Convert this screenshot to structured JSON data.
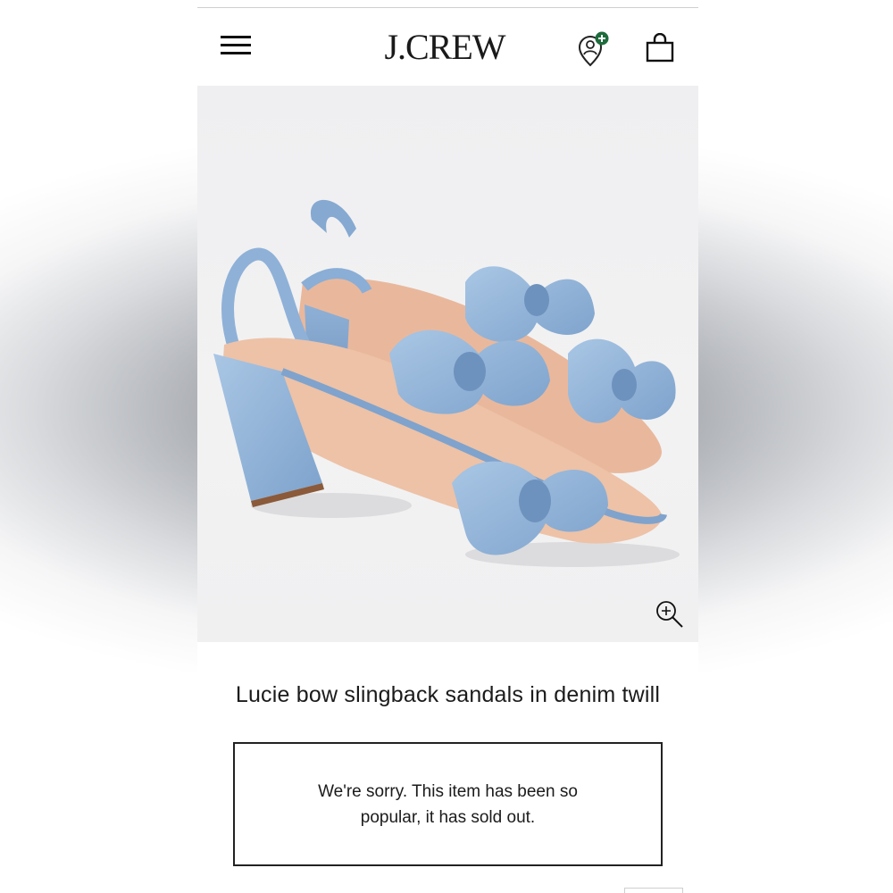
{
  "header": {
    "menu_icon": "hamburger-menu-icon",
    "logo_text": "J.CREW",
    "rewards_icon": "rewards-profile-plus-icon",
    "bag_icon": "shopping-bag-icon",
    "accent_color": "#1e6b3c"
  },
  "product": {
    "image_subject": "blue denim bow slingback block-heel sandals",
    "zoom_icon": "zoom-in-icon",
    "title": "Lucie bow slingback sandals in denim twill"
  },
  "availability": {
    "message": "We're sorry. This item has been so popular, it has sold out."
  }
}
